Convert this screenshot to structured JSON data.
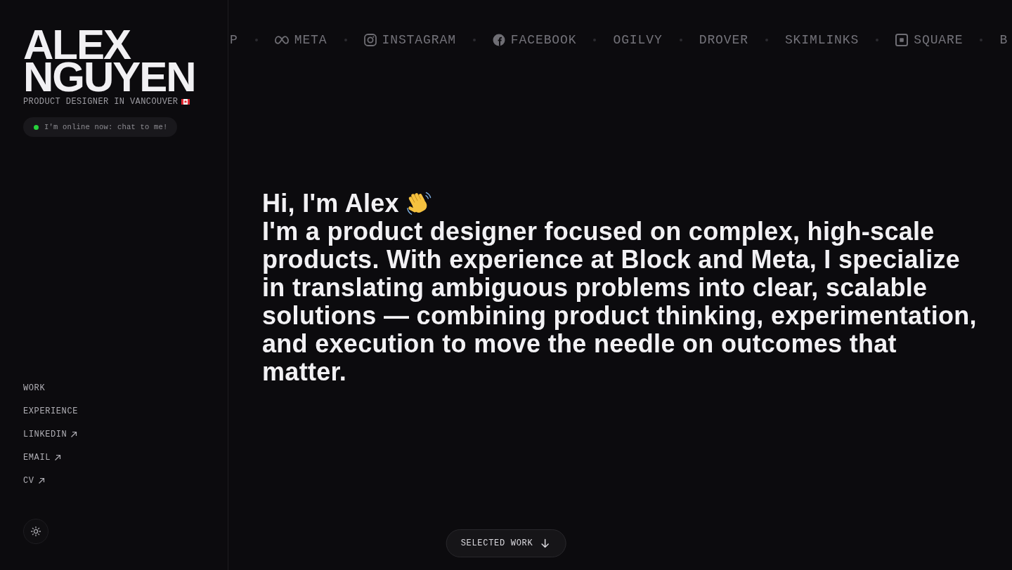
{
  "sidebar": {
    "name": "ALEX NGUYEN",
    "tagline": "PRODUCT DESIGNER IN VANCOUVER",
    "status": {
      "text": "I'm online now: chat to me!",
      "online": true
    },
    "nav": [
      {
        "label": "WORK",
        "kind": "section"
      },
      {
        "label": "EXPERIENCE",
        "kind": "section"
      },
      {
        "label": "LINKEDIN",
        "kind": "external"
      },
      {
        "label": "EMAIL",
        "kind": "external"
      },
      {
        "label": "CV",
        "kind": "external"
      }
    ]
  },
  "ticker": {
    "items": [
      {
        "label": "P",
        "kind": "plain"
      },
      {
        "label": "META",
        "kind": "infinity"
      },
      {
        "label": "INSTAGRAM",
        "kind": "camera"
      },
      {
        "label": "FACEBOOK",
        "kind": "f-circle"
      },
      {
        "label": "OGILVY",
        "kind": "plain"
      },
      {
        "label": "DROVER",
        "kind": "plain"
      },
      {
        "label": "SKIMLINKS",
        "kind": "plain"
      },
      {
        "label": "SQUARE",
        "kind": "square"
      },
      {
        "label": "B",
        "kind": "plain"
      }
    ]
  },
  "hero": {
    "greeting": "Hi, I'm Alex",
    "bio": "I'm a product designer focused on complex, high-scale products. With experience at Block and Meta, I specialize in translating ambiguous problems into clear, scalable solutions — combining product thinking, experimentation, and execution to move the needle on outcomes that matter."
  },
  "cta": {
    "label": "SELECTED WORK"
  }
}
